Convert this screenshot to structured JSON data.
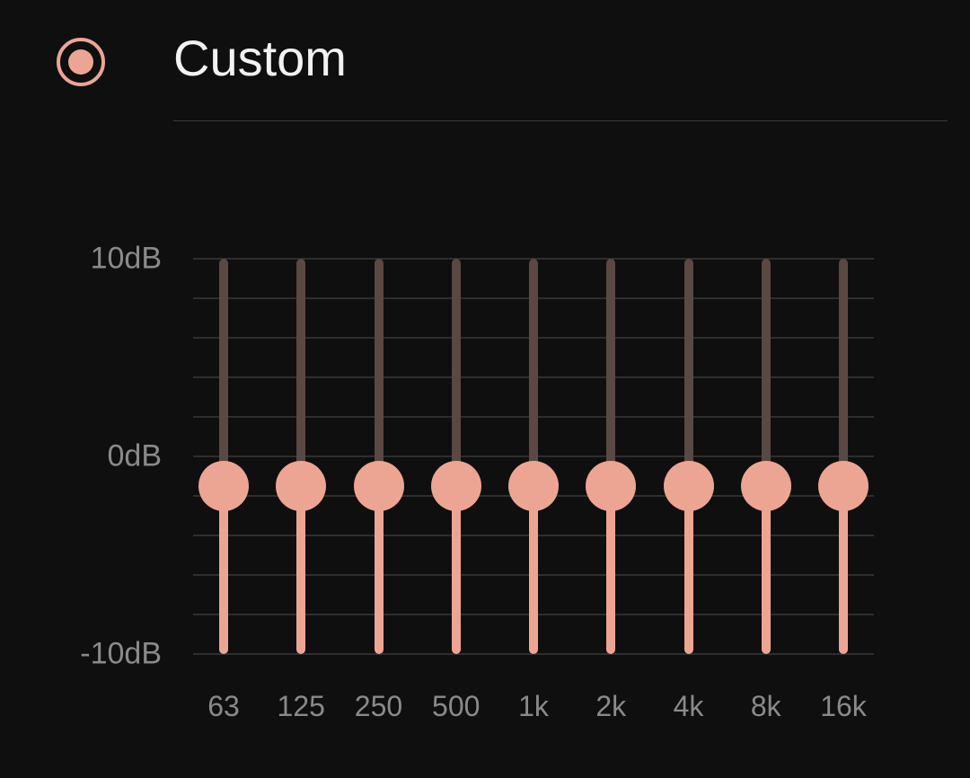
{
  "header": {
    "radio_selected": true,
    "title": "Custom"
  },
  "equalizer": {
    "y_axis": {
      "max_label": "10dB",
      "mid_label": "0dB",
      "min_label": "-10dB",
      "max": 10,
      "min": -10
    },
    "gridline_values": [
      10,
      8,
      6,
      4,
      2,
      0,
      -2,
      -4,
      -6,
      -8,
      -10
    ],
    "bands": [
      {
        "freq_label": "63",
        "value": -1.5
      },
      {
        "freq_label": "125",
        "value": -1.5
      },
      {
        "freq_label": "250",
        "value": -1.5
      },
      {
        "freq_label": "500",
        "value": -1.5
      },
      {
        "freq_label": "1k",
        "value": -1.5
      },
      {
        "freq_label": "2k",
        "value": -1.5
      },
      {
        "freq_label": "4k",
        "value": -1.5
      },
      {
        "freq_label": "8k",
        "value": -1.5
      },
      {
        "freq_label": "16k",
        "value": -1.5
      }
    ]
  },
  "chart_data": {
    "type": "bar",
    "title": "Custom",
    "xlabel": "",
    "ylabel": "",
    "ylim": [
      -10,
      10
    ],
    "categories": [
      "63",
      "125",
      "250",
      "500",
      "1k",
      "2k",
      "4k",
      "8k",
      "16k"
    ],
    "values": [
      -1.5,
      -1.5,
      -1.5,
      -1.5,
      -1.5,
      -1.5,
      -1.5,
      -1.5,
      -1.5
    ],
    "y_tick_labels": [
      "10dB",
      "0dB",
      "-10dB"
    ]
  },
  "colors": {
    "accent": "#eda593",
    "track_inactive": "#5a4842",
    "grid": "#2e2e2e",
    "text_muted": "#8a8a8a"
  }
}
